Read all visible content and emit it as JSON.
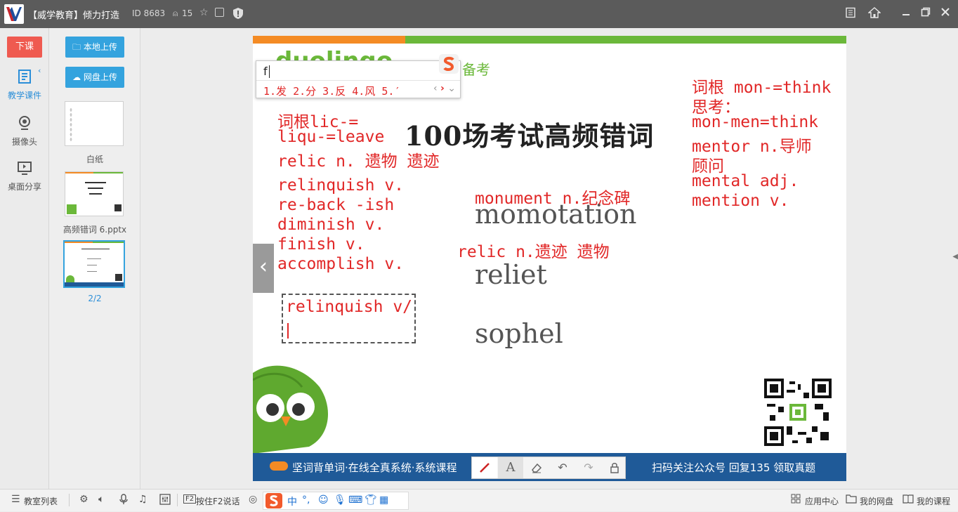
{
  "titlebar": {
    "app_title": "【威学教育】倾力打造",
    "room_id": "ID 8683",
    "online_count": "15"
  },
  "leftnav": {
    "end_class": "下课",
    "courseware": "教学课件",
    "camera": "摄像头",
    "desktop_share": "桌面分享"
  },
  "panel": {
    "local_upload": "本地上传",
    "cloud_upload": "网盘上传",
    "blank_label": "白纸",
    "file_label": "高频错词 6.pptx",
    "page_indicator": "2/2"
  },
  "slide": {
    "prep_text": "备考",
    "brand_partial": "duolingo",
    "title": "100场考试高频错词",
    "words": [
      "momotation",
      "reliet",
      "sophel"
    ],
    "banner_left": "坚词背单词·在线全真系统·系统课程",
    "banner_right": "扫码关注公众号 回复135 领取真题",
    "annotations": {
      "left_block": [
        "词根lic-=",
        "liqu-=leave",
        "relic  n. 遗物 遗迹"
      ],
      "left_list": [
        "relinquish v.",
        "re-back -ish",
        "diminish  v.",
        "finish v.",
        "accomplish v."
      ],
      "monument": "monument n.纪念碑",
      "relic": "relic  n.遗迹 遗物",
      "right_block": [
        "词根 mon-=think",
        "思考：",
        "mon-men=think",
        "mentor n.导师",
        "顾问",
        "mental  adj.",
        "mention v."
      ],
      "edit_box": "relinquish  v/"
    }
  },
  "ime": {
    "input": "f",
    "candidates": "1.发 2.分 3.反 4.风 5.′"
  },
  "statusbar": {
    "classroom_list": "教室列表",
    "f2_key": "F2",
    "f2_label": "按住F2说话",
    "app_center": "应用中心",
    "my_drive": "我的网盘",
    "my_courses": "我的课程"
  }
}
